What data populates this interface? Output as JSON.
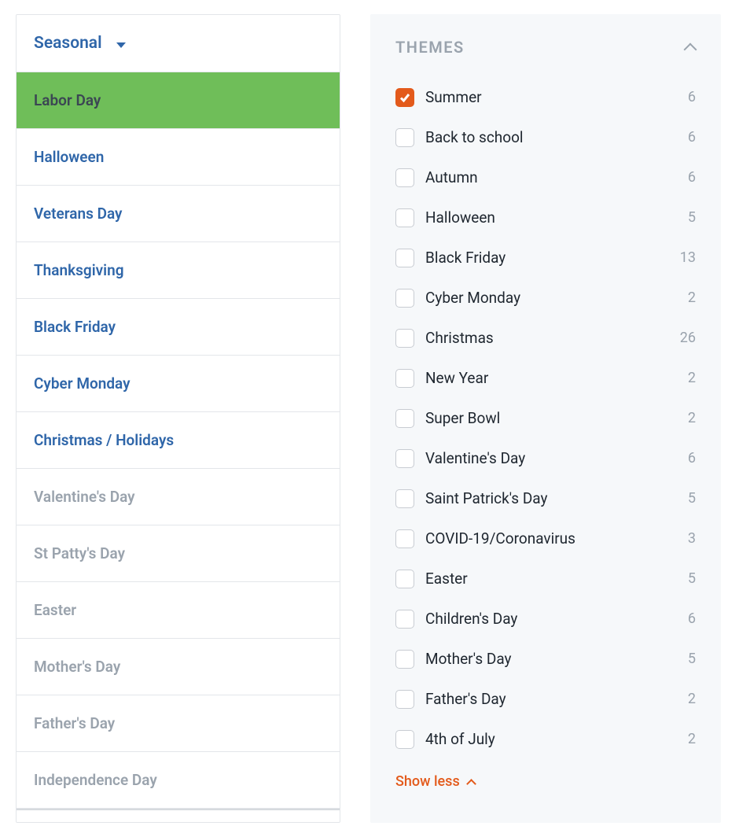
{
  "seasonal": {
    "header_label": "Seasonal",
    "items": [
      {
        "label": "Labor Day",
        "style": "active"
      },
      {
        "label": "Halloween",
        "style": "blue"
      },
      {
        "label": "Veterans Day",
        "style": "blue"
      },
      {
        "label": "Thanksgiving",
        "style": "blue"
      },
      {
        "label": "Black Friday",
        "style": "blue"
      },
      {
        "label": "Cyber Monday",
        "style": "blue"
      },
      {
        "label": "Christmas / Holidays",
        "style": "blue"
      },
      {
        "label": "Valentine's Day",
        "style": "grey"
      },
      {
        "label": "St Patty's Day",
        "style": "grey"
      },
      {
        "label": "Easter",
        "style": "grey"
      },
      {
        "label": "Mother's Day",
        "style": "grey"
      },
      {
        "label": "Father's Day",
        "style": "grey"
      },
      {
        "label": "Independence Day",
        "style": "grey"
      }
    ]
  },
  "themes": {
    "title": "THEMES",
    "show_less_label": "Show less",
    "items": [
      {
        "label": "Summer",
        "count": 6,
        "checked": true
      },
      {
        "label": "Back to school",
        "count": 6,
        "checked": false
      },
      {
        "label": "Autumn",
        "count": 6,
        "checked": false
      },
      {
        "label": "Halloween",
        "count": 5,
        "checked": false
      },
      {
        "label": "Black Friday",
        "count": 13,
        "checked": false
      },
      {
        "label": "Cyber Monday",
        "count": 2,
        "checked": false
      },
      {
        "label": "Christmas",
        "count": 26,
        "checked": false
      },
      {
        "label": "New Year",
        "count": 2,
        "checked": false
      },
      {
        "label": "Super Bowl",
        "count": 2,
        "checked": false
      },
      {
        "label": "Valentine's Day",
        "count": 6,
        "checked": false
      },
      {
        "label": "Saint Patrick's Day",
        "count": 5,
        "checked": false
      },
      {
        "label": "COVID-19/Coronavirus",
        "count": 3,
        "checked": false
      },
      {
        "label": "Easter",
        "count": 5,
        "checked": false
      },
      {
        "label": "Children's Day",
        "count": 6,
        "checked": false
      },
      {
        "label": "Mother's Day",
        "count": 5,
        "checked": false
      },
      {
        "label": "Father's Day",
        "count": 2,
        "checked": false
      },
      {
        "label": "4th of July",
        "count": 2,
        "checked": false
      }
    ]
  }
}
